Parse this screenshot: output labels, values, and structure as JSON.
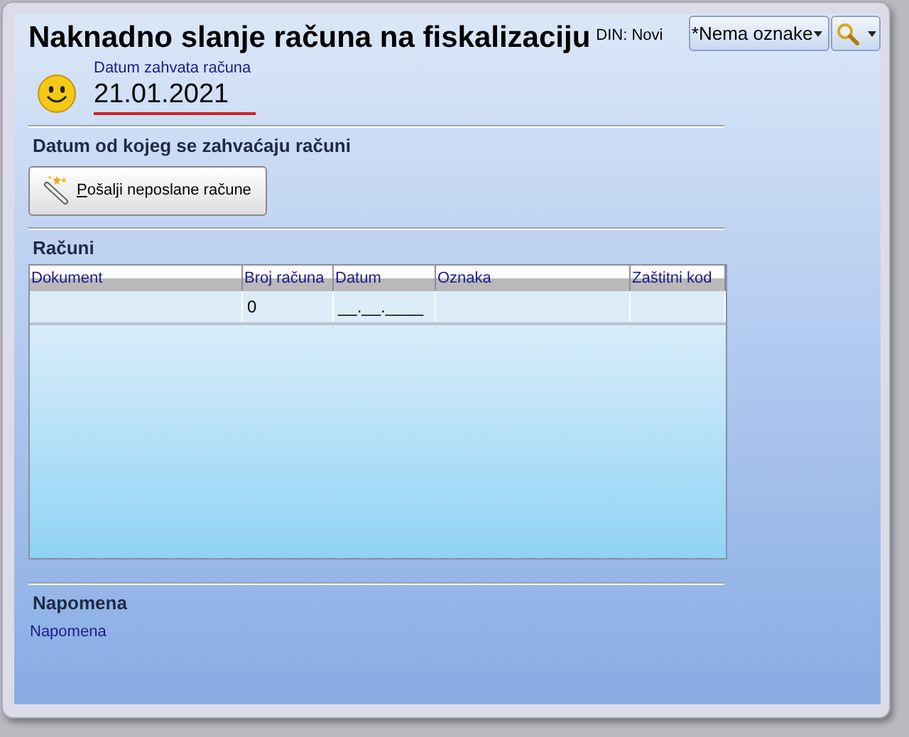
{
  "window": {
    "title": "Naknadno slanje računa na fiskalizaciju",
    "mode": "DIN: Novi"
  },
  "toolbar": {
    "tag_dropdown": "*Nema oznake"
  },
  "capture_date": {
    "label": "Datum zahvata računa",
    "value": "21.01.2021"
  },
  "section_from": {
    "title": "Datum od kojeg se zahvaćaju računi",
    "button": {
      "label": "Pošalji neposlane račune",
      "access_key_underlined": true
    }
  },
  "invoices": {
    "title": "Računi",
    "columns": [
      "Dokument",
      "Broj računa",
      "Datum",
      "Oznaka",
      "Zaštitni kod"
    ],
    "rows": [
      [
        "",
        "0",
        "__.__.____",
        "",
        ""
      ]
    ]
  },
  "note": {
    "title": "Napomena",
    "label": "Napomena"
  }
}
